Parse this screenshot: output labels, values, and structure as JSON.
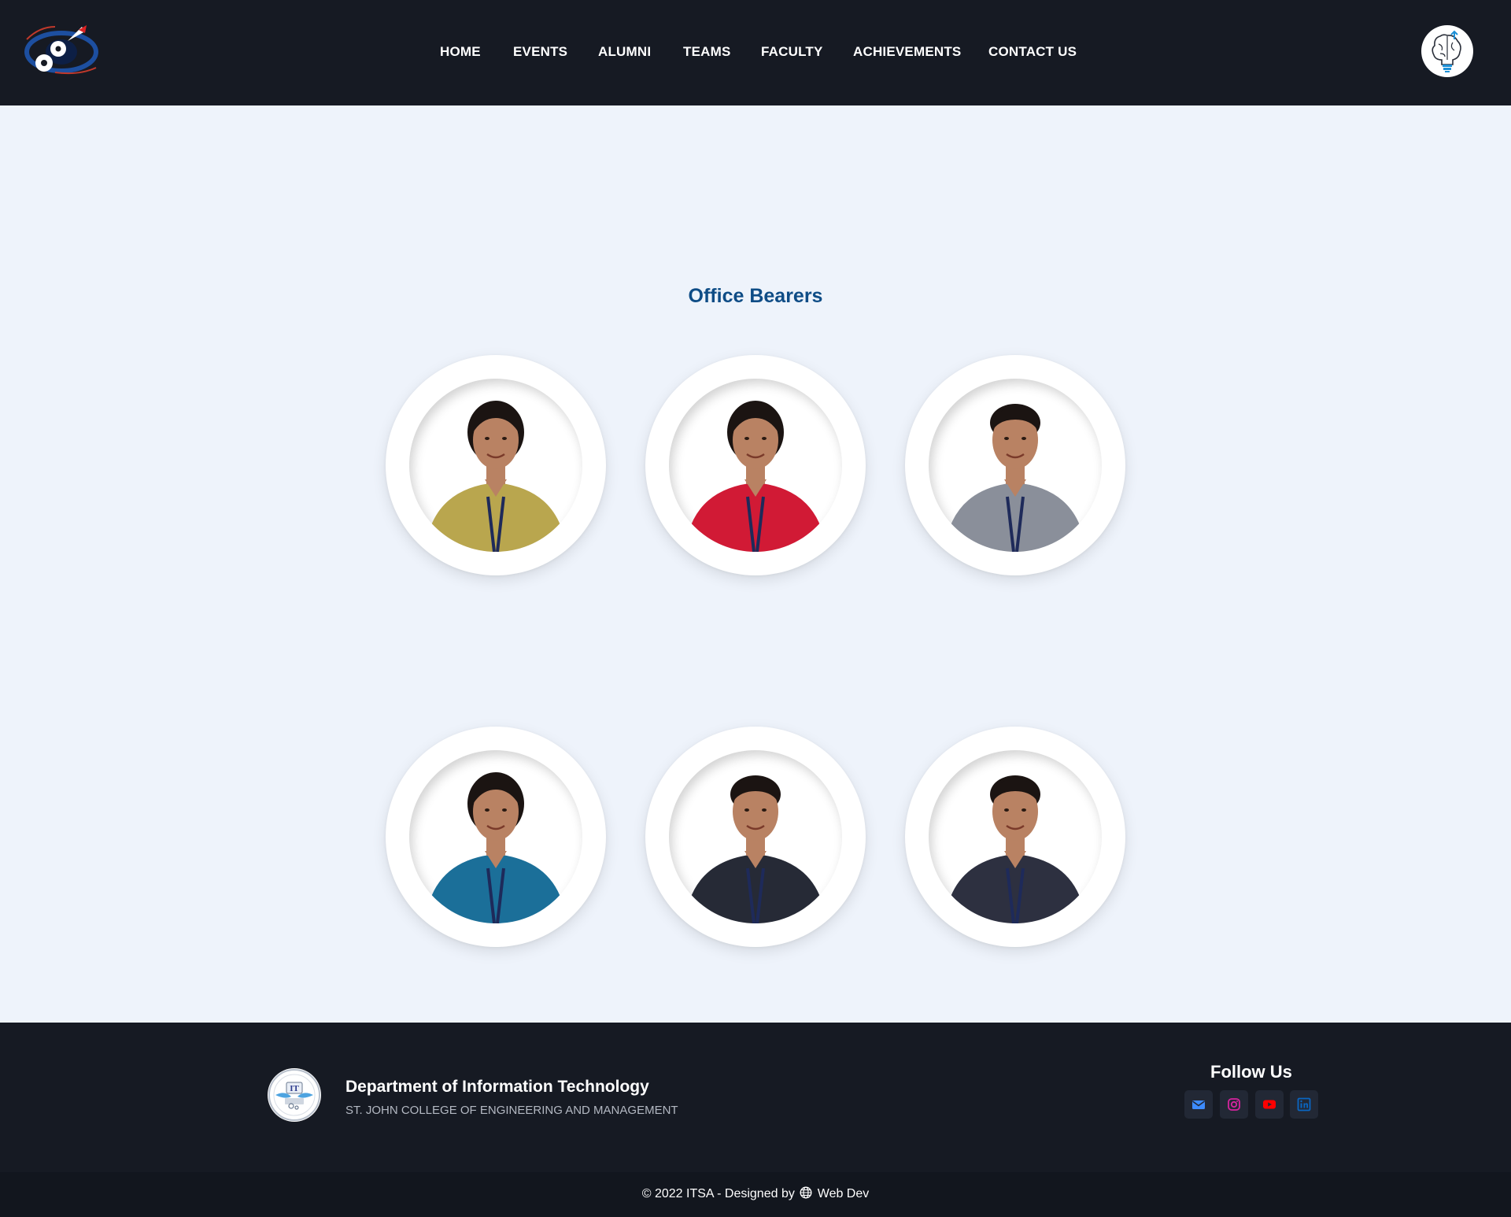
{
  "header": {
    "nav": [
      {
        "label": "HOME"
      },
      {
        "label": "EVENTS"
      },
      {
        "label": "ALUMNI"
      },
      {
        "label": "TEAMS"
      },
      {
        "label": "FACULTY"
      },
      {
        "label": "ACHIEVEMENTS"
      },
      {
        "label": "CONTACT US"
      }
    ],
    "left_logo_icon": "college-logo-icon",
    "right_logo_icon": "brain-bulb-logo-icon"
  },
  "main": {
    "section_title": "Office Bearers",
    "bearers": [
      {
        "photo": "bearer-photo-1",
        "shirt_color": "#b9a64e",
        "hair": "long"
      },
      {
        "photo": "bearer-photo-2",
        "shirt_color": "#d11a35",
        "hair": "long"
      },
      {
        "photo": "bearer-photo-3",
        "shirt_color": "#8a8f9a",
        "hair": "short"
      },
      {
        "photo": "bearer-photo-4",
        "shirt_color": "#1b6f99",
        "hair": "long"
      },
      {
        "photo": "bearer-photo-5",
        "shirt_color": "#262a36",
        "hair": "short"
      },
      {
        "photo": "bearer-photo-6",
        "shirt_color": "#2d3040",
        "hair": "short"
      }
    ]
  },
  "footer": {
    "dept_name": "Department of Information Technology",
    "college_name": "ST. JOHN COLLEGE OF ENGINEERING AND MANAGEMENT",
    "follow_title": "Follow Us",
    "socials": [
      {
        "icon": "email-icon",
        "color": "#3d8bfd"
      },
      {
        "icon": "instagram-icon",
        "color": "#d6249f"
      },
      {
        "icon": "youtube-icon",
        "color": "#ff0000"
      },
      {
        "icon": "linkedin-icon",
        "color": "#0a66c2"
      }
    ],
    "copyright_prefix": "© 2022 ITSA - Designed by",
    "copyright_suffix": "Web Dev"
  },
  "colors": {
    "header_bg": "#161a23",
    "page_bg": "#eef3fb",
    "title_color": "#0e4c86"
  }
}
